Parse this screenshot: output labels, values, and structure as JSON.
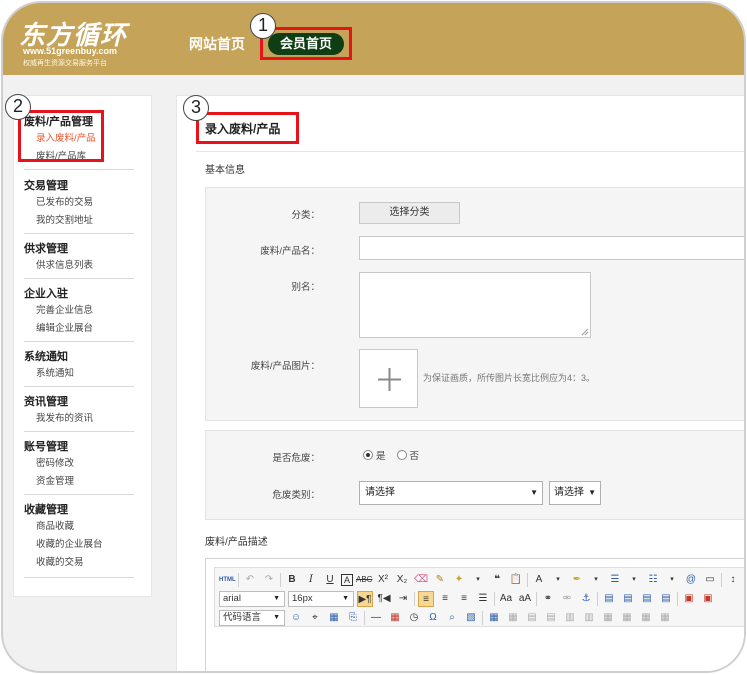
{
  "header": {
    "logo_text": "东方循环",
    "logo_url": "www.51greenbuy.com",
    "logo_tagline": "权威再生资源交易服务平台",
    "nav_home": "网站首页",
    "nav_member": "会员首页",
    "bg_color": "#c5a45a"
  },
  "callouts": [
    "1",
    "2",
    "3"
  ],
  "sidebar": {
    "groups": [
      {
        "title": "废料/产品管理",
        "items": [
          "录入废料/产品",
          "废料/产品库"
        ]
      },
      {
        "title": "交易管理",
        "items": [
          "已发布的交易",
          "我的交割地址"
        ]
      },
      {
        "title": "供求管理",
        "items": [
          "供求信息列表"
        ]
      },
      {
        "title": "企业入驻",
        "items": [
          "完善企业信息",
          "编辑企业展台"
        ]
      },
      {
        "title": "系统通知",
        "items": [
          "系统通知"
        ]
      },
      {
        "title": "资讯管理",
        "items": [
          "我发布的资讯"
        ]
      },
      {
        "title": "账号管理",
        "items": [
          "密码修改",
          "资金管理"
        ]
      },
      {
        "title": "收藏管理",
        "items": [
          "商品收藏",
          "收藏的企业展台",
          "收藏的交易"
        ]
      }
    ],
    "active_color": "#e8542a"
  },
  "main": {
    "page_title": "录入废料/产品",
    "basic_info": {
      "section_title": "基本信息",
      "category_label": "分类：",
      "category_button": "选择分类",
      "name_label": "废料/产品名：",
      "alias_label": "别名：",
      "image_label": "废料/产品图片：",
      "image_hint": "为保证画质，所传图片长宽比例应为4：3。"
    },
    "hazard": {
      "hazard_label": "是否危废：",
      "yes_label": "是",
      "no_label": "否",
      "yes_selected": true,
      "type_label": "危废类别：",
      "type_select_value": "请选择",
      "sub_select_value": "请选择"
    },
    "description": {
      "section_title": "废料/产品描述",
      "font_family": "arial",
      "font_size": "16px",
      "code_language": "代码语言"
    }
  },
  "highlight_color": "#e8121a"
}
